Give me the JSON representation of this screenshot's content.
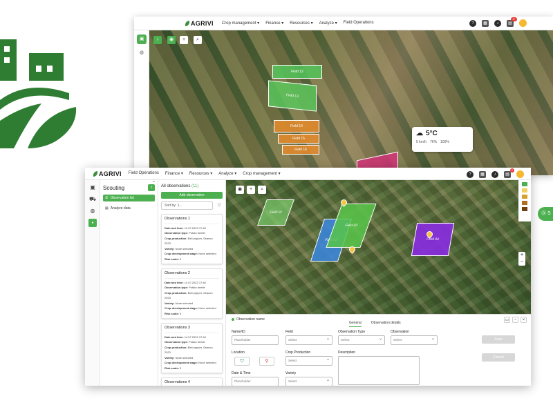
{
  "back_window": {
    "brand": "AGRIVI",
    "nav": [
      "Crop management ▾",
      "Finance ▾",
      "Resources ▾",
      "Analyze ▾",
      "Field Operations"
    ],
    "notification_count": "9+",
    "fields": [
      {
        "label": "Field 12",
        "color": "#52c45a"
      },
      {
        "label": "Field 13",
        "color": "#5cc65c"
      },
      {
        "label": "Field 14",
        "color": "#e08a2c"
      },
      {
        "label": "Field 15",
        "color": "#e08a2c"
      },
      {
        "label": "Field 16",
        "color": "#e08a2c"
      }
    ],
    "weather": {
      "temp": "5°C",
      "wind": "5 km/h",
      "humidity": "76%",
      "clouds": "100%"
    }
  },
  "front_window": {
    "brand": "AGRIVI",
    "nav": [
      "Field Operations",
      "Finance ▾",
      "Resources ▾",
      "Analyze ▾",
      "Crop management ▾"
    ],
    "notification_count": "2",
    "scouting": {
      "title": "Scouting",
      "items": [
        "Observation list",
        "Analyze data"
      ]
    },
    "observations": {
      "heading": "All observations",
      "count": "(11)",
      "add_label": "Add observation",
      "sort_label": "Sort by: 1...",
      "cards": [
        {
          "title": "Observations 1",
          "date": "14.07.2023 17:46",
          "type": "Potato beetle",
          "production": "Bell pepper, Season 2023",
          "variety": "None selected",
          "stage": "None selected",
          "risk": "5"
        },
        {
          "title": "Observations 2",
          "date": "14.07.2023 17:46",
          "type": "Potato beetle",
          "production": "Bell pepper, Season 2023",
          "variety": "None selected",
          "stage": "None selected",
          "risk": "5"
        },
        {
          "title": "Observations 3",
          "date": "14.07.2023 17:46",
          "type": "Potato beetle",
          "production": "Bell pepper, Season 2023",
          "variety": "None selected",
          "stage": "None selected",
          "risk": "5"
        },
        {
          "title": "Observations 4"
        }
      ],
      "labels": {
        "date": "Date and time:",
        "type": "Observation type:",
        "production": "Crop production:",
        "variety": "Variety:",
        "stage": "Crop development stage:",
        "risk": "Risk scale:"
      }
    },
    "map_fields": [
      {
        "label": "Field 01",
        "color": "#7ccd6c"
      },
      {
        "label": "Field 02",
        "color": "#3a86e0"
      },
      {
        "label": "Field 03",
        "color": "#58c64a"
      },
      {
        "label": "Field 04",
        "color": "#8a2be2"
      }
    ],
    "panel": {
      "title": "Observation name",
      "tabs": [
        "General",
        "Observation details"
      ],
      "name_label": "Name/ID",
      "name_placeholder": "Placeholder",
      "location_label": "Location",
      "date_label": "Date & Time",
      "date_placeholder": "Placeholder",
      "field_label": "Field",
      "field_value": "Select",
      "crop_label": "Crop Production",
      "crop_value": "Select",
      "variety_label": "Variety",
      "variety_value": "Select",
      "obs_type_label": "Observation Type",
      "obs_type_value": "Select",
      "observation_label": "Observation",
      "observation_value": "Select",
      "description_label": "Description",
      "save_label": "Save",
      "cancel_label": "Cancel"
    }
  },
  "side_cta": "S"
}
